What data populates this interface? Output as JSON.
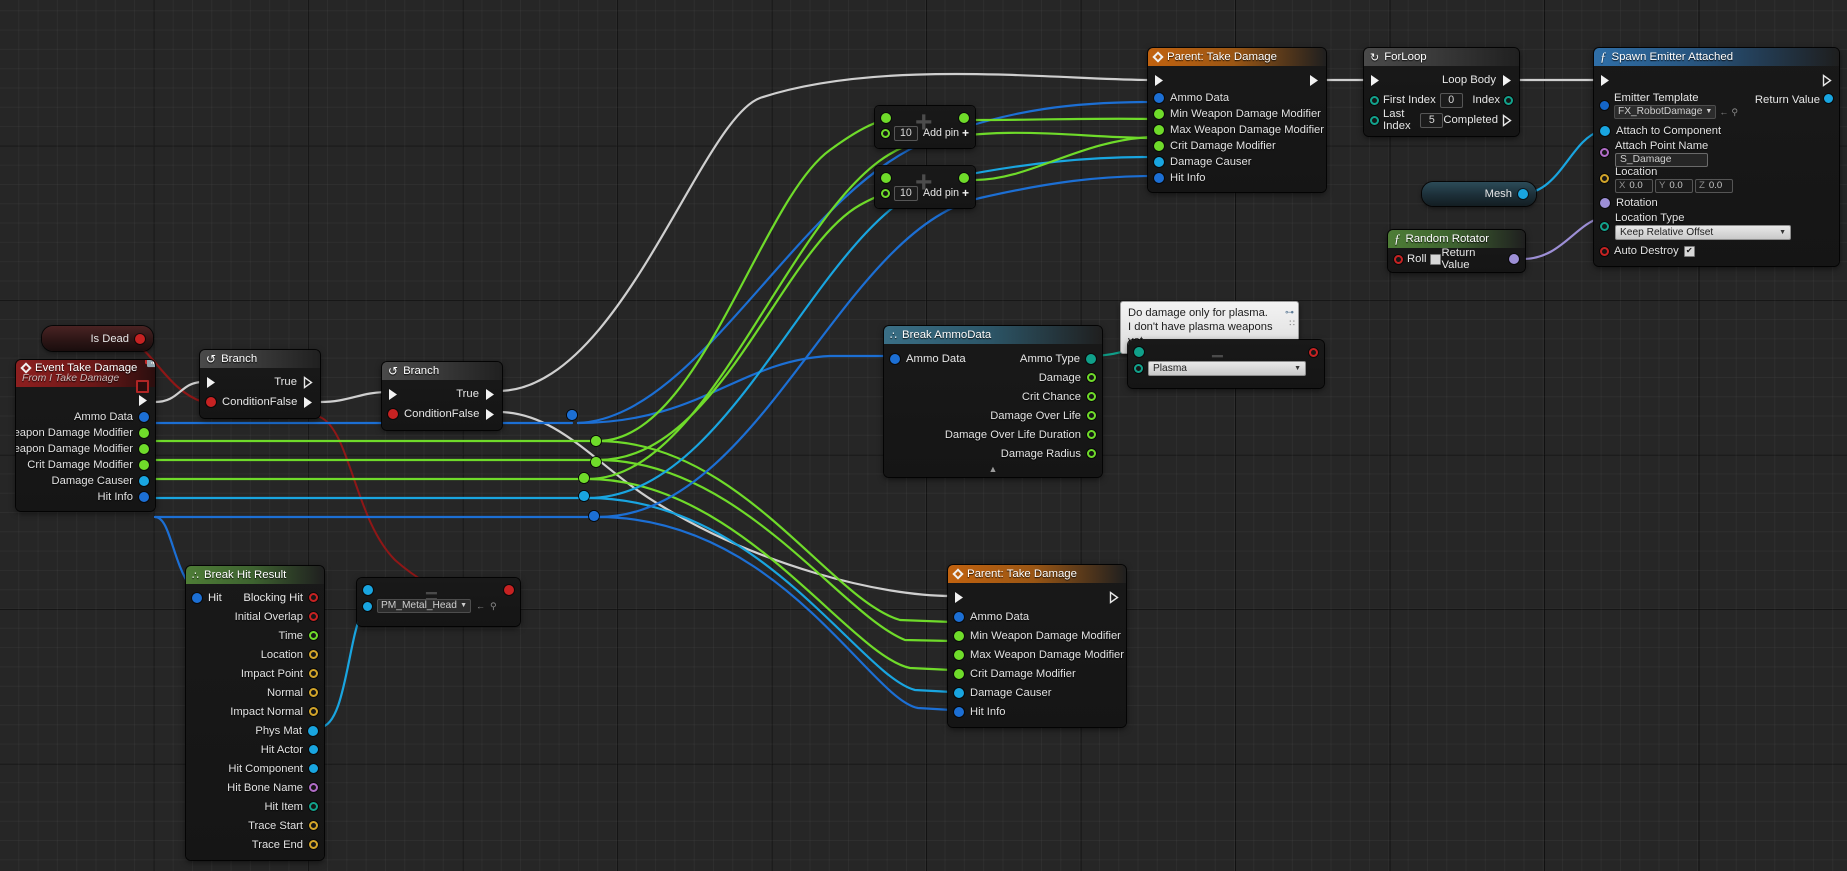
{
  "app": {
    "name": "Unreal Engine Blueprint Event Graph"
  },
  "nodes": {
    "is_dead": {
      "title": "Is Dead"
    },
    "event_take_damage": {
      "title": "Event Take Damage",
      "subtitle": "From I Take Damage",
      "outputs": [
        "Ammo Data",
        "Min Weapon Damage Modifier",
        "Max Weapon Damage Modifier",
        "Crit Damage Modifier",
        "Damage Causer",
        "Hit Info"
      ]
    },
    "branch_1": {
      "title": "Branch",
      "condition": "Condition",
      "true": "True",
      "false": "False"
    },
    "branch_2": {
      "title": "Branch",
      "condition": "Condition",
      "true": "True",
      "false": "False"
    },
    "add_1": {
      "value": "10",
      "add_pin": "Add pin"
    },
    "add_2": {
      "value": "10",
      "add_pin": "Add pin"
    },
    "parent_take_damage_top": {
      "title": "Parent: Take Damage",
      "inputs": [
        "Ammo Data",
        "Min Weapon Damage Modifier",
        "Max Weapon Damage Modifier",
        "Crit Damage Modifier",
        "Damage Causer",
        "Hit Info"
      ]
    },
    "parent_take_damage_bottom": {
      "title": "Parent: Take Damage",
      "inputs": [
        "Ammo Data",
        "Min Weapon Damage Modifier",
        "Max Weapon Damage Modifier",
        "Crit Damage Modifier",
        "Damage Causer",
        "Hit Info"
      ]
    },
    "for_loop": {
      "title": "ForLoop",
      "first_index_label": "First Index",
      "first_index_value": "0",
      "last_index_label": "Last Index",
      "last_index_value": "5",
      "loop_body": "Loop Body",
      "index": "Index",
      "completed": "Completed"
    },
    "mesh": {
      "title": "Mesh"
    },
    "random_rotator": {
      "title": "Random Rotator",
      "roll": "Roll",
      "return_value": "Return Value"
    },
    "spawn_emitter": {
      "title": "Spawn Emitter Attached",
      "emitter_template_label": "Emitter Template",
      "emitter_template_value": "FX_RobotDamage",
      "attach_to_component": "Attach to Component",
      "attach_point_name_label": "Attach Point Name",
      "attach_point_name_value": "S_Damage",
      "location_label": "Location",
      "location_x": "0.0",
      "location_y": "0.0",
      "location_z": "0.0",
      "axis_x": "X",
      "axis_y": "Y",
      "axis_z": "Z",
      "rotation": "Rotation",
      "location_type_label": "Location Type",
      "location_type_value": "Keep Relative Offset",
      "auto_destroy": "Auto Destroy",
      "return_value": "Return Value"
    },
    "break_ammo_data": {
      "title": "Break AmmoData",
      "input": "Ammo Data",
      "outputs": [
        "Ammo Type",
        "Damage",
        "Crit Chance",
        "Damage Over Life",
        "Damage Over Life Duration",
        "Damage Radius"
      ]
    },
    "comment": {
      "line1": "Do damage only for plasma.",
      "line2": "I don't have plasma weapons yet."
    },
    "enum_equal": {
      "value": "Plasma"
    },
    "break_hit_result": {
      "title": "Break Hit Result",
      "input": "Hit",
      "outputs": [
        "Blocking Hit",
        "Initial Overlap",
        "Time",
        "Location",
        "Impact Point",
        "Normal",
        "Impact Normal",
        "Phys Mat",
        "Hit Actor",
        "Hit Component",
        "Hit Bone Name",
        "Hit Item",
        "Trace Start",
        "Trace End"
      ]
    },
    "pm_metal_head": {
      "value": "PM_Metal_Head"
    }
  },
  "colors": {
    "exec_wire": "#cfcfcf",
    "bool_wire": "#8f1717",
    "object_wire": "#1c6fd4",
    "float_wire": "#6fdb2a",
    "struct_wire": "#19a5e0",
    "rotator_wire": "#9d8fd6",
    "enum_wire": "#10a08a",
    "canvas_bg": "#262626"
  }
}
